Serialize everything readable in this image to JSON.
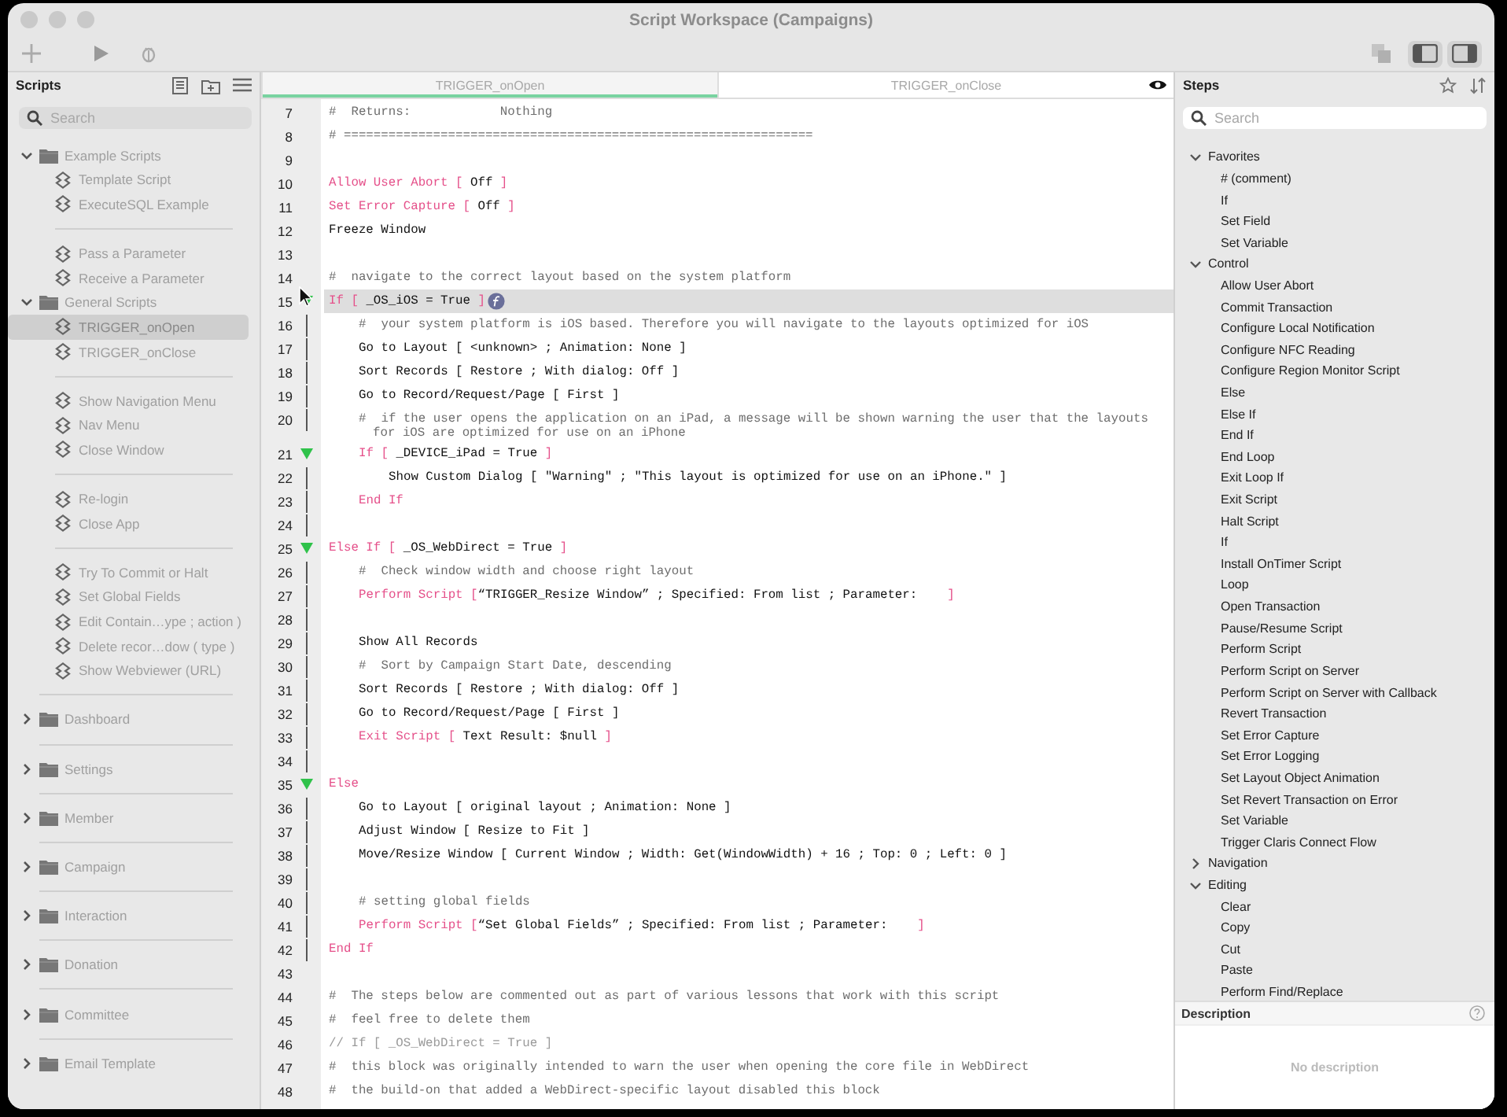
{
  "window": {
    "title": "Script Workspace (Campaigns)"
  },
  "scripts_panel": {
    "title": "Scripts",
    "search": {
      "placeholder": "Search"
    },
    "items": [
      {
        "kind": "folder",
        "label": "Example Scripts",
        "expanded": true,
        "children": [
          {
            "kind": "script",
            "label": "Template Script",
            "selected": false
          },
          {
            "kind": "script",
            "label": "ExecuteSQL Example",
            "selected": false
          },
          {
            "kind": "separator"
          },
          {
            "kind": "script",
            "label": "Pass a Parameter",
            "selected": false
          },
          {
            "kind": "script",
            "label": "Receive a Parameter",
            "selected": false
          }
        ]
      },
      {
        "kind": "folder",
        "label": "General Scripts",
        "expanded": true,
        "children": [
          {
            "kind": "script",
            "label": "TRIGGER_onOpen",
            "selected": true
          },
          {
            "kind": "script",
            "label": "TRIGGER_onClose",
            "selected": false
          },
          {
            "kind": "separator"
          },
          {
            "kind": "script",
            "label": "Show Navigation Menu",
            "selected": false
          },
          {
            "kind": "script",
            "label": "Nav Menu",
            "selected": false
          },
          {
            "kind": "script",
            "label": "Close Window",
            "selected": false
          },
          {
            "kind": "separator"
          },
          {
            "kind": "script",
            "label": "Re-login",
            "selected": false
          },
          {
            "kind": "script",
            "label": "Close App",
            "selected": false
          },
          {
            "kind": "separator"
          },
          {
            "kind": "script",
            "label": "Try To Commit or Halt",
            "selected": false
          },
          {
            "kind": "script",
            "label": "Set Global Fields",
            "selected": false
          },
          {
            "kind": "script",
            "label": "Edit Contain…ype ; action )",
            "selected": false
          },
          {
            "kind": "script",
            "label": "Delete recor…dow  ( type )",
            "selected": false
          },
          {
            "kind": "script",
            "label": "Show Webviewer (URL)",
            "selected": false
          }
        ]
      },
      {
        "kind": "separator"
      },
      {
        "kind": "folder",
        "label": "Dashboard",
        "expanded": false
      },
      {
        "kind": "separator"
      },
      {
        "kind": "folder",
        "label": "Settings",
        "expanded": false
      },
      {
        "kind": "separator"
      },
      {
        "kind": "folder",
        "label": "Member",
        "expanded": false
      },
      {
        "kind": "separator"
      },
      {
        "kind": "folder",
        "label": "Campaign",
        "expanded": false
      },
      {
        "kind": "separator"
      },
      {
        "kind": "folder",
        "label": "Interaction",
        "expanded": false
      },
      {
        "kind": "separator"
      },
      {
        "kind": "folder",
        "label": "Donation",
        "expanded": false
      },
      {
        "kind": "separator"
      },
      {
        "kind": "folder",
        "label": "Committee",
        "expanded": false
      },
      {
        "kind": "separator"
      },
      {
        "kind": "folder",
        "label": "Email Template",
        "expanded": false
      }
    ]
  },
  "editor": {
    "tabs": [
      {
        "label": "TRIGGER_onOpen",
        "selected": true
      },
      {
        "label": "TRIGGER_onClose",
        "selected": false
      }
    ],
    "lines": [
      {
        "num": "7",
        "selected": false,
        "kind": "top",
        "segments": [
          {
            "kind": "comment",
            "text": "#  Returns:            Nothing"
          }
        ]
      },
      {
        "num": "8",
        "selected": false,
        "kind": "top",
        "segments": [
          {
            "kind": "comment",
            "text": "# ==============================================================="
          }
        ]
      },
      {
        "num": "9",
        "selected": false,
        "kind": "top"
      },
      {
        "num": "10",
        "selected": false,
        "kind": "top",
        "segments": [
          {
            "kind": "control",
            "text": "Allow User Abort ["
          },
          {
            "kind": "plain",
            "text": " Off "
          },
          {
            "kind": "control",
            "text": "]"
          }
        ]
      },
      {
        "num": "11",
        "selected": false,
        "kind": "top",
        "segments": [
          {
            "kind": "control",
            "text": "Set Error Capture ["
          },
          {
            "kind": "plain",
            "text": " Off "
          },
          {
            "kind": "control",
            "text": "]"
          }
        ]
      },
      {
        "num": "12",
        "selected": false,
        "kind": "top",
        "segments": [
          {
            "kind": "plain",
            "text": "Freeze Window"
          }
        ]
      },
      {
        "num": "13",
        "selected": false,
        "kind": "top"
      },
      {
        "num": "14",
        "selected": false,
        "kind": "top",
        "segments": [
          {
            "kind": "comment",
            "text": "#  navigate to the correct layout based on the system platform"
          }
        ]
      },
      {
        "num": "15",
        "selected": true,
        "kind": "fold",
        "segments": [
          {
            "kind": "control",
            "text": "If ["
          },
          {
            "kind": "plain",
            "text": " _OS_iOS = True "
          },
          {
            "kind": "control",
            "text": "]"
          },
          {
            "kind": "badge"
          }
        ],
        "children": [
          {
            "num": "16",
            "selected": false,
            "kind": "nested",
            "segments": [
              {
                "kind": "comment",
                "text": "#  your system platform is iOS based. Therefore you will navigate to the layouts optimized for iOS"
              }
            ]
          },
          {
            "num": "17",
            "selected": false,
            "kind": "nested",
            "segments": [
              {
                "kind": "plain",
                "text": "Go to Layout [ <unknown> ; Animation: None ]"
              }
            ]
          },
          {
            "num": "18",
            "selected": false,
            "kind": "nested",
            "segments": [
              {
                "kind": "plain",
                "text": "Sort Records [ Restore ; With dialog: Off ]"
              }
            ]
          },
          {
            "num": "19",
            "selected": false,
            "kind": "nested",
            "segments": [
              {
                "kind": "plain",
                "text": "Go to Record/Request/Page [ First ]"
              }
            ]
          },
          {
            "num": "20",
            "selected": false,
            "kind": "nested",
            "segments": [
              {
                "kind": "comment",
                "text": "#  if the user opens the application on an iPad, a message will be shown warning the user that the layouts for iOS are optimized for use on an iPhone"
              }
            ]
          },
          {
            "num": "21",
            "selected": false,
            "kind": "fold",
            "segments": [
              {
                "kind": "control",
                "text": "If ["
              },
              {
                "kind": "plain",
                "text": " _DEVICE_iPad = True "
              },
              {
                "kind": "control",
                "text": "]"
              }
            ],
            "children": [
              {
                "num": "22",
                "selected": false,
                "kind": "nested",
                "segments": [
                  {
                    "kind": "plain",
                    "text": "Show Custom Dialog [ \"Warning\" ; \"This layout is optimized for use on an iPhone.\" ]"
                  }
                ]
              }
            ]
          },
          {
            "num": "23",
            "selected": false,
            "kind": "nested",
            "segments": [
              {
                "kind": "control",
                "text": "End If"
              }
            ]
          },
          {
            "num": "24",
            "selected": false,
            "kind": "nested"
          }
        ]
      },
      {
        "num": "25",
        "selected": false,
        "kind": "fold",
        "segments": [
          {
            "kind": "control",
            "text": "Else If ["
          },
          {
            "kind": "plain",
            "text": " _OS_WebDirect = True "
          },
          {
            "kind": "control",
            "text": "]"
          }
        ],
        "children": [
          {
            "num": "26",
            "selected": false,
            "kind": "nested",
            "segments": [
              {
                "kind": "comment",
                "text": "#  Check window width and choose right layout"
              }
            ]
          },
          {
            "num": "27",
            "selected": false,
            "kind": "nested",
            "segments": [
              {
                "kind": "control",
                "text": "Perform Script ["
              },
              {
                "kind": "plain",
                "text": "“TRIGGER_Resize Window” ; Specified: From list ; Parameter:    "
              },
              {
                "kind": "control",
                "text": "]"
              }
            ]
          },
          {
            "num": "28",
            "selected": false,
            "kind": "nested"
          },
          {
            "num": "29",
            "selected": false,
            "kind": "nested",
            "segments": [
              {
                "kind": "plain",
                "text": "Show All Records"
              }
            ]
          },
          {
            "num": "30",
            "selected": false,
            "kind": "nested",
            "segments": [
              {
                "kind": "comment",
                "text": "#  Sort by Campaign Start Date, descending"
              }
            ]
          },
          {
            "num": "31",
            "selected": false,
            "kind": "nested",
            "segments": [
              {
                "kind": "plain",
                "text": "Sort Records [ Restore ; With dialog: Off ]"
              }
            ]
          },
          {
            "num": "32",
            "selected": false,
            "kind": "nested",
            "segments": [
              {
                "kind": "plain",
                "text": "Go to Record/Request/Page [ First ]"
              }
            ]
          },
          {
            "num": "33",
            "selected": false,
            "kind": "nested",
            "segments": [
              {
                "kind": "control",
                "text": "Exit Script ["
              },
              {
                "kind": "plain",
                "text": " Text Result: $null "
              },
              {
                "kind": "control",
                "text": "]"
              }
            ]
          },
          {
            "num": "34",
            "selected": false,
            "kind": "nested"
          }
        ]
      },
      {
        "num": "35",
        "selected": false,
        "kind": "fold",
        "segments": [
          {
            "kind": "control",
            "text": "Else"
          }
        ],
        "children": [
          {
            "num": "36",
            "selected": false,
            "kind": "nested",
            "segments": [
              {
                "kind": "plain",
                "text": "Go to Layout [ original layout ; Animation: None ]"
              }
            ]
          },
          {
            "num": "37",
            "selected": false,
            "kind": "nested",
            "segments": [
              {
                "kind": "plain",
                "text": "Adjust Window [ Resize to Fit ]"
              }
            ]
          },
          {
            "num": "38",
            "selected": false,
            "kind": "nested",
            "segments": [
              {
                "kind": "plain",
                "text": "Move/Resize Window [ Current Window ; Width: Get(WindowWidth) + 16 ; Top: 0 ; Left: 0 ]"
              }
            ]
          },
          {
            "num": "39",
            "selected": false,
            "kind": "nested"
          },
          {
            "num": "40",
            "selected": false,
            "kind": "nested",
            "segments": [
              {
                "kind": "comment",
                "text": "# setting global fields"
              }
            ]
          },
          {
            "num": "41",
            "selected": false,
            "kind": "nested",
            "segments": [
              {
                "kind": "control",
                "text": "Perform Script ["
              },
              {
                "kind": "plain",
                "text": "“Set Global Fields” ; Specified: From list ; Parameter:    "
              },
              {
                "kind": "control",
                "text": "]"
              }
            ]
          }
        ]
      },
      {
        "num": "42",
        "selected": false,
        "kind": "nested",
        "segments": [
          {
            "kind": "control",
            "text": "End If"
          }
        ]
      },
      {
        "num": "43",
        "selected": false,
        "kind": "top"
      },
      {
        "num": "44",
        "selected": false,
        "kind": "top",
        "segments": [
          {
            "kind": "comment",
            "text": "#  The steps below are commented out as part of various lessons that work with this script"
          }
        ]
      },
      {
        "num": "45",
        "selected": false,
        "kind": "top",
        "segments": [
          {
            "kind": "comment",
            "text": "#  feel free to delete them"
          }
        ]
      },
      {
        "num": "46",
        "selected": false,
        "kind": "top",
        "segments": [
          {
            "kind": "disabled",
            "text": "// If [ _OS_WebDirect = True ]"
          }
        ]
      },
      {
        "num": "47",
        "selected": false,
        "kind": "top",
        "segments": [
          {
            "kind": "comment",
            "text": "#  this block was originally intended to warn the user when opening the core file in WebDirect"
          }
        ]
      },
      {
        "num": "48",
        "selected": false,
        "kind": "top",
        "segments": [
          {
            "kind": "comment",
            "text": "#  the build-on that added a WebDirect-specific layout disabled this block"
          }
        ]
      }
    ]
  },
  "steps_panel": {
    "title": "Steps",
    "search": {
      "placeholder": "Search"
    },
    "categories": [
      {
        "label": "Favorites",
        "expanded": true,
        "children": [
          "# (comment)",
          "If",
          "Set Field",
          "Set Variable"
        ]
      },
      {
        "label": "Control",
        "expanded": true,
        "children": [
          "Allow User Abort",
          "Commit Transaction",
          "Configure Local Notification",
          "Configure NFC Reading",
          "Configure Region Monitor Script",
          "Else",
          "Else If",
          "End If",
          "End Loop",
          "Exit Loop If",
          "Exit Script",
          "Halt Script",
          "If",
          "Install OnTimer Script",
          "Loop",
          "Open Transaction",
          "Pause/Resume Script",
          "Perform Script",
          "Perform Script on Server",
          "Perform Script on Server with Callback",
          "Revert Transaction",
          "Set Error Capture",
          "Set Error Logging",
          "Set Layout Object Animation",
          "Set Revert Transaction on Error",
          "Set Variable",
          "Trigger Claris Connect Flow"
        ]
      },
      {
        "label": "Navigation",
        "expanded": false
      },
      {
        "label": "Editing",
        "expanded": true,
        "children": [
          "Clear",
          "Copy",
          "Cut",
          "Paste",
          "Perform Find/Replace"
        ]
      }
    ],
    "description": {
      "title": "Description",
      "text": "No description"
    }
  }
}
